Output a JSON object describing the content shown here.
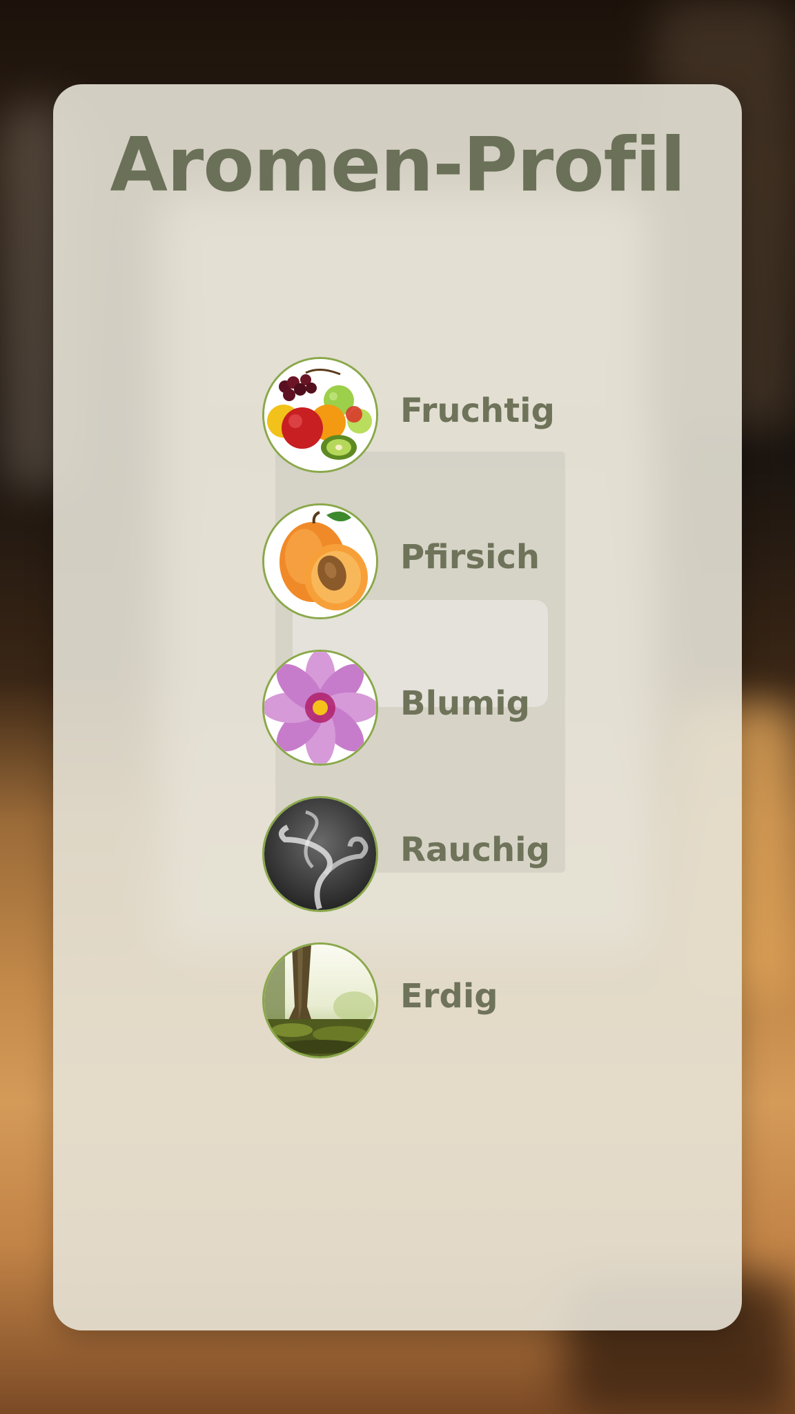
{
  "screen": {
    "title": "Aromen-Profil"
  },
  "aromas": [
    {
      "label": "Fruchtig",
      "icon": "fruit-basket-icon"
    },
    {
      "label": "Pfirsich",
      "icon": "peach-icon"
    },
    {
      "label": "Blumig",
      "icon": "flower-icon"
    },
    {
      "label": "Rauchig",
      "icon": "smoke-icon"
    },
    {
      "label": "Erdig",
      "icon": "forest-ground-icon"
    }
  ],
  "colors": {
    "title": "#6b7158",
    "label": "#6e7359",
    "icon_ring": "#8aa84a",
    "card": "#e6e2d6"
  }
}
